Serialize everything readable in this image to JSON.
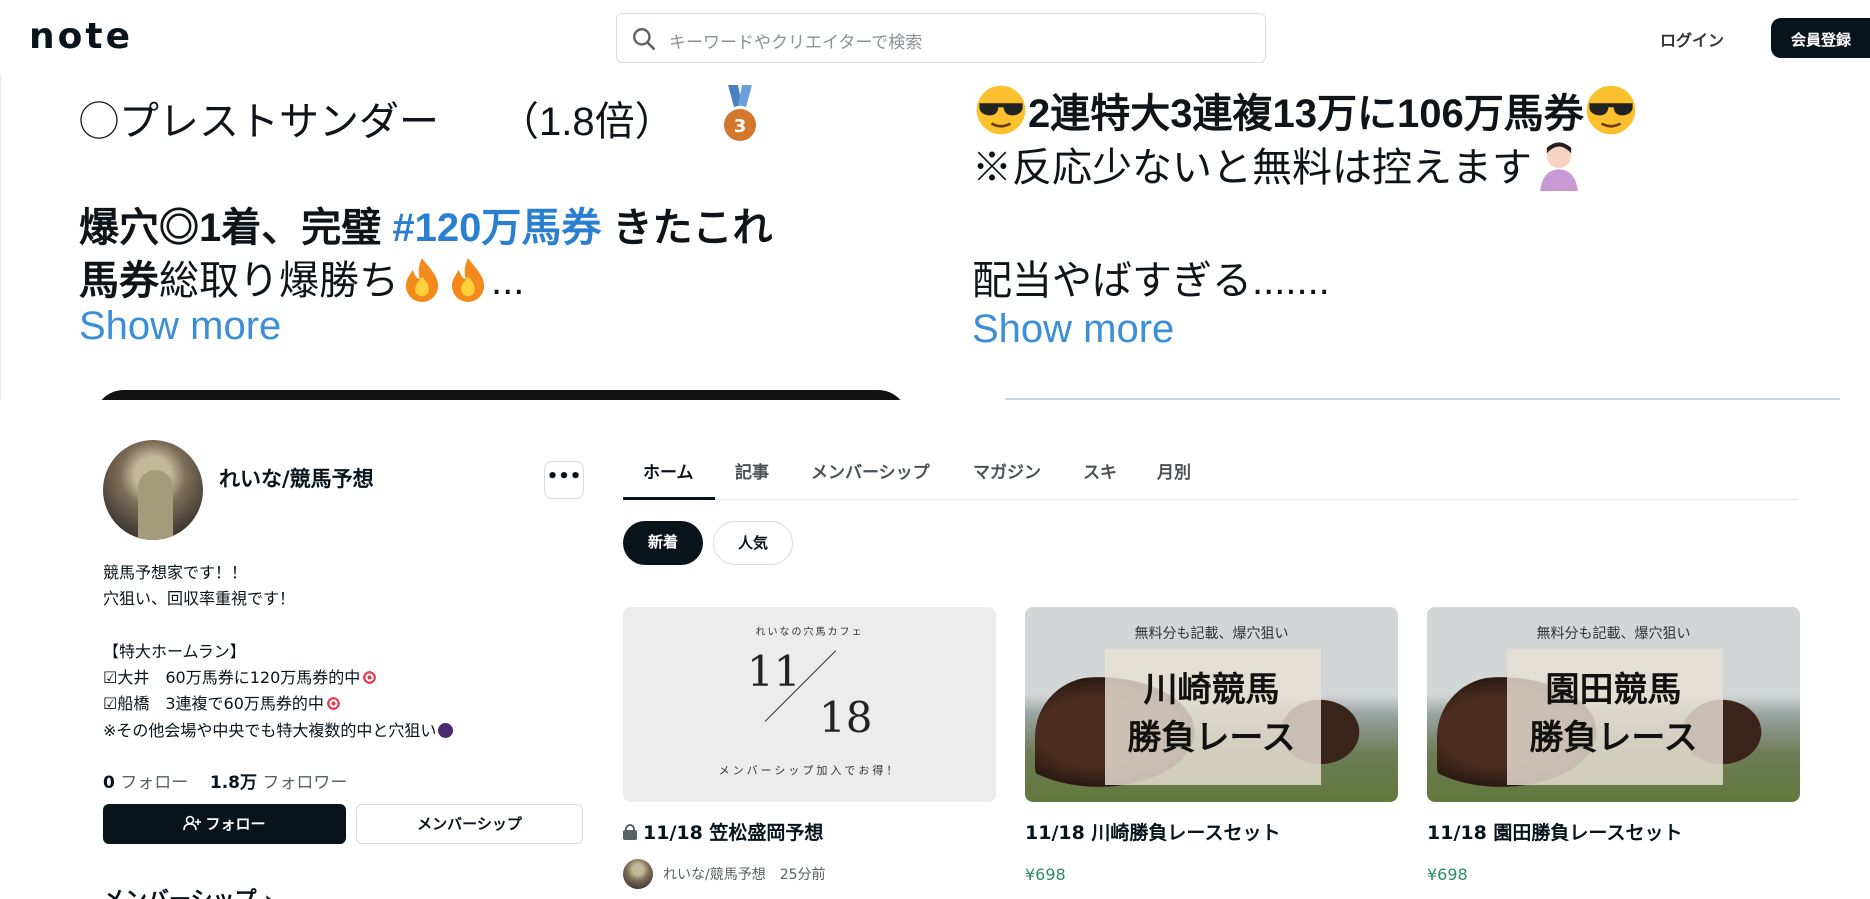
{
  "header": {
    "logo": "note",
    "search_placeholder": "キーワードやクリエイターで検索",
    "login_label": "ログイン",
    "signup_label": "会員登録"
  },
  "banner": {
    "left": {
      "line1": "◯プレストサンダー　　（1.8倍）",
      "line2_a": "爆穴◎1着、完璧 ",
      "line2_hash": "#120万馬券",
      "line2_b": " きたこれ",
      "line3_a": "馬券",
      "line3_b": "総取り爆勝ち",
      "line3_c": "...",
      "show_more": "Show more"
    },
    "right": {
      "line1": "2連特大3連複13万に106万馬券",
      "line2": "※反応少ないと無料は控えます",
      "line3": "配当やばすぎる.......",
      "show_more": "Show more"
    }
  },
  "profile": {
    "name": "れいな/競馬予想",
    "more_label": "•••",
    "bio": [
      "競馬予想家です！！",
      "穴狙い、回収率重視です！",
      "",
      "【特大ホームラン】",
      "☑大井　60万馬券に120万馬券的中",
      "☑船橋　3連複で60万馬券的中",
      "※その他会場や中央でも特大複数的中と穴狙い"
    ],
    "follow_count": "0",
    "follow_label": "フォロー",
    "follower_count": "1.8万",
    "follower_label": "フォロワー",
    "follow_button": "フォロー",
    "membership_button": "メンバーシップ",
    "membership_heading": "メンバーシップ ›"
  },
  "tabs": [
    "ホーム",
    "記事",
    "メンバーシップ",
    "マガジン",
    "スキ",
    "月別"
  ],
  "active_tab": "ホーム",
  "filters": {
    "new": "新着",
    "popular": "人気"
  },
  "cards": [
    {
      "thumb_top": "れいなの穴馬カフェ",
      "thumb_month": "11",
      "thumb_day": "18",
      "thumb_bottom": "メンバーシップ加入でお得！",
      "title": "11/18 笠松盛岡予想",
      "author": "れいな/競馬予想",
      "time": "25分前",
      "locked": true
    },
    {
      "thumb_sub": "無料分も記載、爆穴狙い",
      "thumb_big1": "川崎競馬",
      "thumb_big2": "勝負レース",
      "title": "11/18 川崎勝負レースセット",
      "price": "¥698"
    },
    {
      "thumb_sub": "無料分も記載、爆穴狙い",
      "thumb_big1": "園田競馬",
      "thumb_big2": "勝負レース",
      "title": "11/18 園田勝負レースセット",
      "price": "¥698"
    }
  ],
  "colors": {
    "accent": "#08131a",
    "link": "#3a8fd6",
    "price": "#2a8c6a"
  }
}
